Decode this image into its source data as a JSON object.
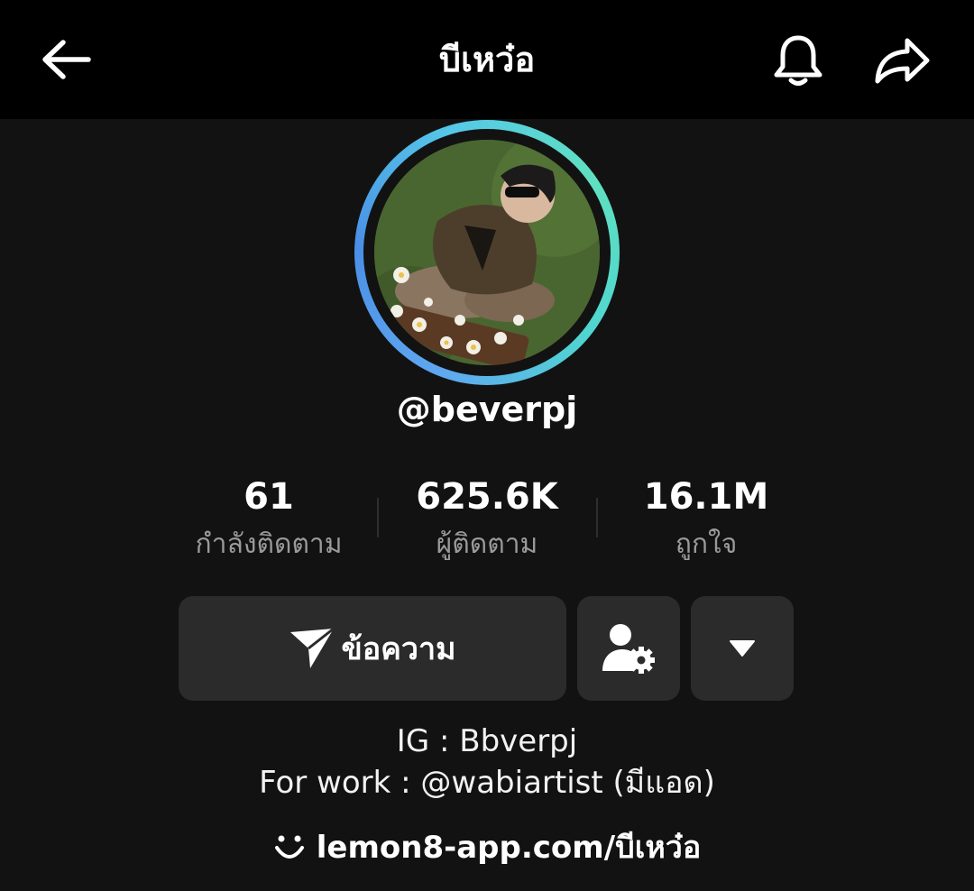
{
  "header": {
    "title": "บีเหว๋อ",
    "back_icon": "arrow-left-icon",
    "bell_icon": "bell-icon",
    "share_icon": "share-arrow-icon"
  },
  "profile": {
    "handle": "@beverpj",
    "avatar_ring_colors": [
      "#5fa8f0",
      "#5fe0c0"
    ]
  },
  "stats": [
    {
      "value": "61",
      "label": "กำลังติดตาม"
    },
    {
      "value": "625.6K",
      "label": "ผู้ติดตาม"
    },
    {
      "value": "16.1M",
      "label": "ถูกใจ"
    }
  ],
  "actions": {
    "message_label": "ข้อความ",
    "message_icon": "paper-plane-icon",
    "add_friend_icon": "user-settings-icon",
    "more_icon": "caret-down-icon"
  },
  "bio": {
    "line1": "IG : Bbverpj",
    "line2": "For work : @wabiartist (มีแอด)"
  },
  "link": {
    "icon": "lemon8-smile-icon",
    "text": "lemon8-app.com/บีเหว๋อ"
  }
}
